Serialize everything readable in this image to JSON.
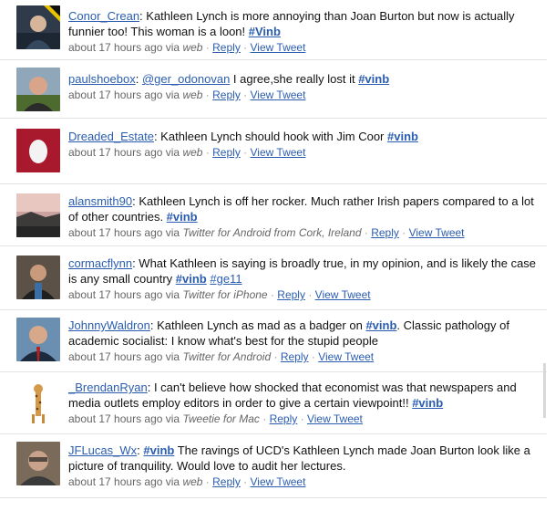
{
  "tweets": [
    {
      "user": "Conor_Crean",
      "text_before": ": Kathleen Lynch is more annoying than Joan Burton but now is actually funnier too! This woman is a loon! ",
      "tag1": "#Vinb",
      "text_after": "",
      "tag2": "",
      "meta": {
        "time": "about 17 hours ago via",
        "source": "web",
        "location": "",
        "reply": "Reply",
        "view": "View Tweet"
      }
    },
    {
      "user": "paulshoebox",
      "text_before": ": ",
      "mention": "@ger_odonovan",
      "text_mid": " I agree,she really lost it ",
      "tag1": "#vinb",
      "meta": {
        "time": "about 17 hours ago via",
        "source": "web",
        "location": "",
        "reply": "Reply",
        "view": "View Tweet"
      }
    },
    {
      "user": "Dreaded_Estate",
      "text_before": ": Kathleen Lynch should hook with Jim Coor ",
      "tag1": "#vinb",
      "meta": {
        "time": "about 17 hours ago via",
        "source": "web",
        "location": "",
        "reply": "Reply",
        "view": "View Tweet"
      }
    },
    {
      "user": "alansmith90",
      "text_before": ": Kathleen Lynch is off her rocker. Much rather Irish papers compared to a lot of other countries. ",
      "tag1": "#vinb",
      "meta": {
        "time": "about 17 hours ago via",
        "source": "Twitter for Android",
        "location": "from Cork, Ireland",
        "reply": "Reply",
        "view": "View Tweet"
      }
    },
    {
      "user": "cormacflynn",
      "text_before": ": What Kathleen is saying is broadly true, in my opinion, and is likely the case is any small country ",
      "tag1": "#vinb",
      "tag2": "#ge11",
      "meta": {
        "time": "about 17 hours ago via",
        "source": "Twitter for iPhone",
        "location": "",
        "reply": "Reply",
        "view": "View Tweet"
      }
    },
    {
      "user": "JohnnyWaldron",
      "text_before": ": Kathleen Lynch as mad as a badger on ",
      "tag1": "#vinb",
      "text_after": ". Classic pathology of academic socialist: I know what's best for the stupid people",
      "meta": {
        "time": "about 17 hours ago via",
        "source": "Twitter for Android",
        "location": "",
        "reply": "Reply",
        "view": "View Tweet"
      }
    },
    {
      "user": "_BrendanRyan",
      "text_before": ": I can't believe how shocked that economist was that newspapers and media outlets employ editors in order to give a certain viewpoint!! ",
      "tag1": "#vinb",
      "meta": {
        "time": "about 17 hours ago via",
        "source": "Tweetie for Mac",
        "location": "",
        "reply": "Reply",
        "view": "View Tweet"
      }
    },
    {
      "user": "JFLucas_Wx",
      "text_before": ": ",
      "tag1": "#vinb",
      "text_after": " The ravings of UCD's Kathleen Lynch made Joan Burton look like a picture of tranquility. Would love to audit her lectures.",
      "meta": {
        "time": "about 17 hours ago via",
        "source": "web",
        "location": "",
        "reply": "Reply",
        "view": "View Tweet"
      }
    }
  ],
  "separator": "·",
  "colors": {
    "link": "#2a5db0",
    "meta": "#666666",
    "divider": "#e3e3e3"
  }
}
